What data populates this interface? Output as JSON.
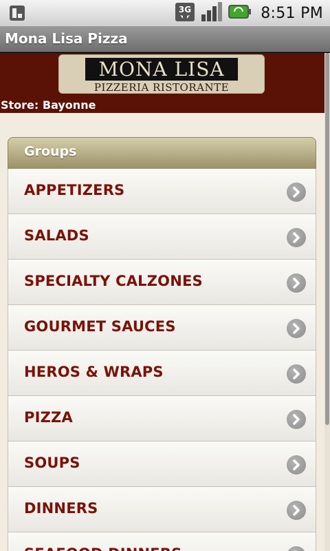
{
  "status_bar": {
    "time": "8:51 PM",
    "network": "3G"
  },
  "app": {
    "title": "Mona Lisa Pizza"
  },
  "header": {
    "logo_name": "MONA LISA",
    "logo_sub": "PIZZERIA RISTORANTE",
    "store": "Store: Bayonne"
  },
  "groups": {
    "heading": "Groups",
    "items": [
      {
        "label": "APPETIZERS"
      },
      {
        "label": "SALADS"
      },
      {
        "label": "SPECIALTY CALZONES"
      },
      {
        "label": "GOURMET SAUCES"
      },
      {
        "label": "HEROS & WRAPS"
      },
      {
        "label": "PIZZA"
      },
      {
        "label": "SOUPS"
      },
      {
        "label": "DINNERS"
      },
      {
        "label": "SEAFOOD DINNERS"
      }
    ]
  },
  "colors": {
    "header_bg": "#5a1207",
    "item_text": "#7a1208",
    "panel_head": "#9c9269"
  }
}
